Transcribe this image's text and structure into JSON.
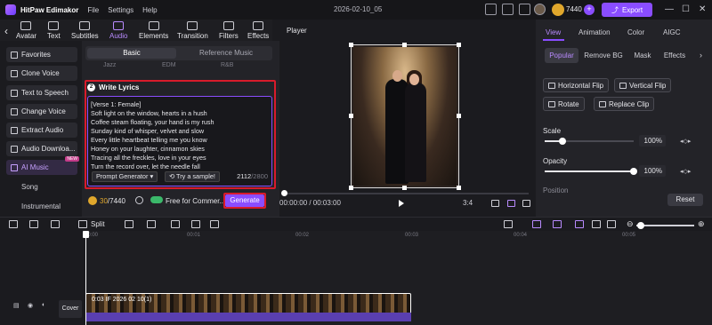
{
  "titlebar": {
    "app_name": "HitPaw Edimakor",
    "menu": [
      "File",
      "Settings",
      "Help"
    ],
    "doc_title": "2026-02-10_05",
    "credits": "7440",
    "export_label": "Export"
  },
  "toolbar": {
    "tools": [
      "Avatar",
      "Text",
      "Subtitles",
      "Audio",
      "Elements",
      "Transition",
      "Filters",
      "Effects"
    ],
    "active": "Audio"
  },
  "sidebar": {
    "items": [
      "Favorites",
      "Clone Voice",
      "Text to Speech",
      "Change Voice",
      "Extract Audio",
      "Audio Downloa...",
      "AI Music"
    ],
    "new_badge": "NEW",
    "sub_items": [
      "Song",
      "Instrumental"
    ]
  },
  "panel": {
    "tab_basic": "Basic",
    "tab_reference": "Reference Music",
    "ghost_row": [
      "Jazz",
      "EDM",
      "R&B"
    ],
    "lyrics_step": "2",
    "lyrics_title": "Write Lyrics",
    "lyrics": [
      "[Verse 1: Female]",
      "Soft light on the window, hearts in a hush",
      "Coffee steam floating, your hand is my rush",
      "Sunday kind of whisper, velvet and slow",
      "Every little heartbeat telling me you know",
      "Honey on your laughter, cinnamon skies",
      "Tracing all the freckles, love in your eyes",
      "Turn the record over, let the needle fall"
    ],
    "prompt_generator": "Prompt Generator",
    "try_sample": "Try a sample!",
    "char_used": "2112",
    "char_max": "/2800",
    "credit_used": "30",
    "credit_total": "/7440",
    "free_commercial": "Free for Commer...",
    "generate": "Generate"
  },
  "player": {
    "label": "Player",
    "timecode": "00:00:00 / 00:03:00",
    "aspect": "3:4"
  },
  "rpanel": {
    "tabs": [
      "View",
      "Animation",
      "Color",
      "AIGC"
    ],
    "sub_tabs": [
      "Popular",
      "Remove BG",
      "Mask",
      "Effects"
    ],
    "actions": [
      "Horizontal Flip",
      "Vertical Flip",
      "Rotate",
      "Replace Clip"
    ],
    "scale_label": "Scale",
    "scale_value": "100%",
    "scale_fraction": 0.2,
    "opacity_label": "Opacity",
    "opacity_value": "100%",
    "opacity_fraction": 1.0,
    "position_label": "Position",
    "reset": "Reset"
  },
  "timeline_toolbar": {
    "split": "Split"
  },
  "timeline": {
    "ruler": [
      "00:00",
      "00:01",
      "00:02",
      "00:03",
      "00:04",
      "00:05"
    ],
    "cover": "Cover",
    "clip_label": "0:03 IF 2026 02 10(1)"
  },
  "colors": {
    "accent": "#8a4dff",
    "highlight_outline": "#d81b2b",
    "gold": "#e0a72c"
  }
}
